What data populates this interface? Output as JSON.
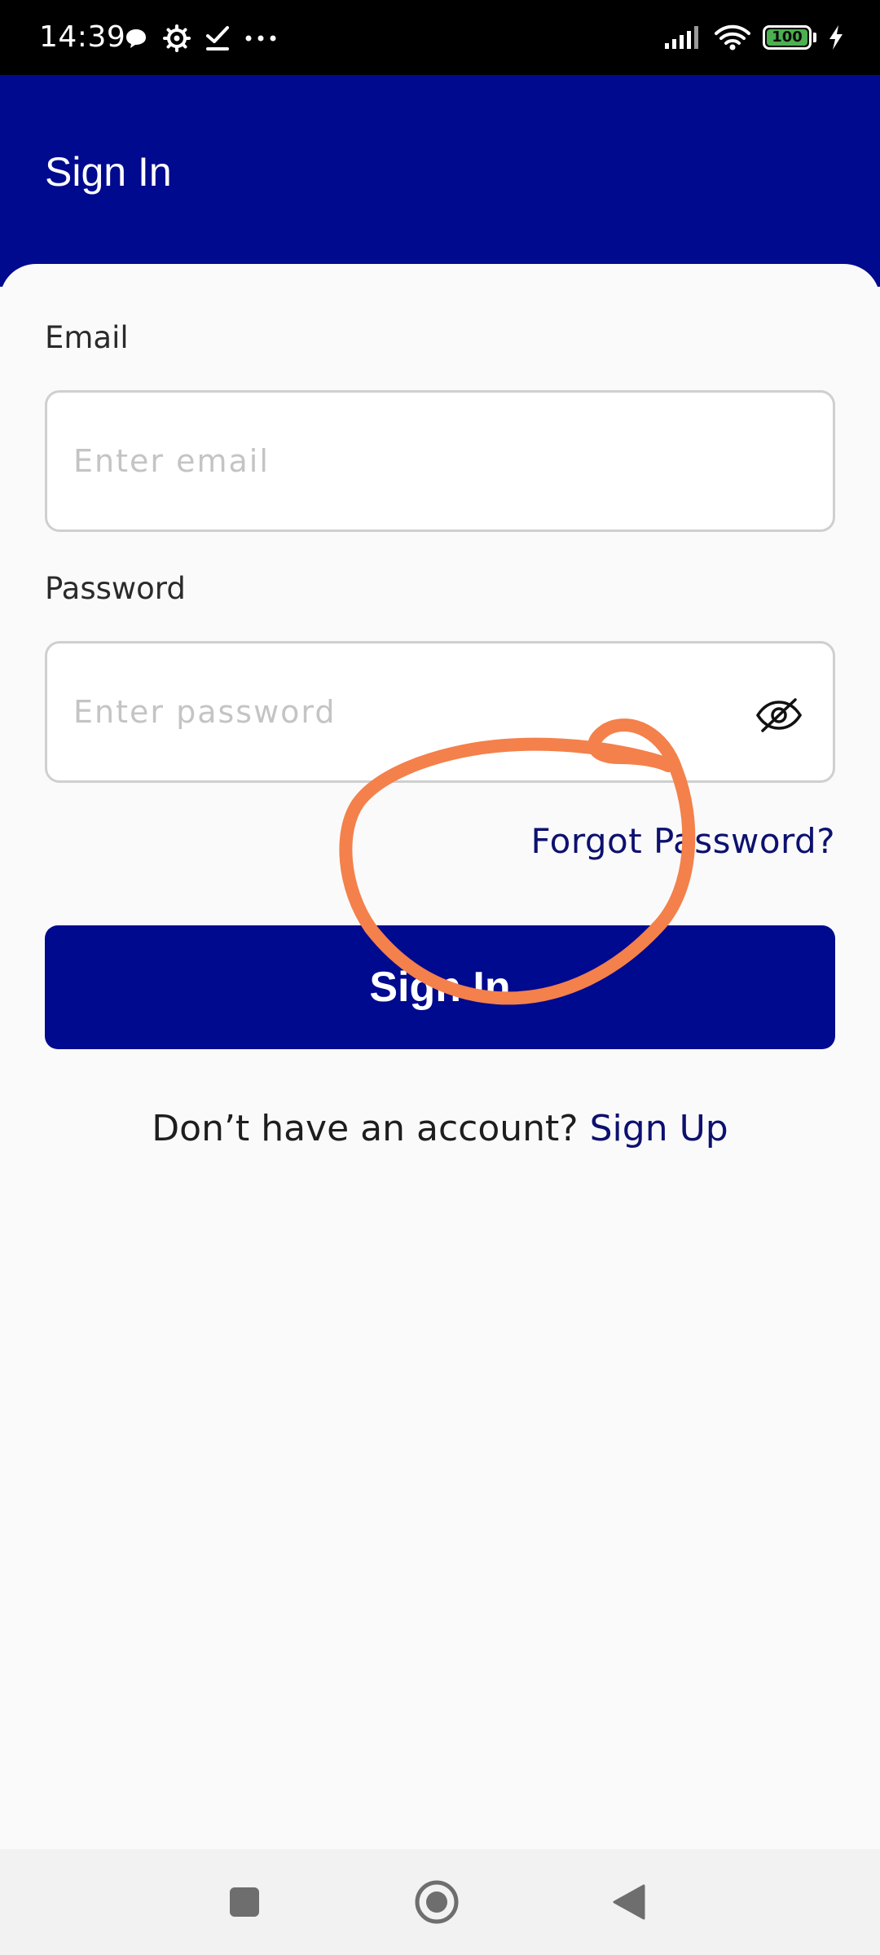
{
  "status_bar": {
    "time": "14:39",
    "battery_level": "100",
    "battery_color": "#4caf50",
    "icons": [
      "chat-bubble-icon",
      "settings-icon",
      "check-icon",
      "more-dots-icon",
      "signal-icon",
      "wifi-icon",
      "battery-icon",
      "charging-icon"
    ]
  },
  "header": {
    "title": "Sign In",
    "background_color": "#000a8e"
  },
  "form": {
    "email": {
      "label": "Email",
      "placeholder": "Enter email",
      "value": ""
    },
    "password": {
      "label": "Password",
      "placeholder": "Enter password",
      "value": "",
      "visibility_icon": "eye-off-icon"
    },
    "forgot_password_label": "Forgot Password?",
    "submit_label": "Sign In"
  },
  "signup": {
    "prompt": "Don’t have an account?",
    "link_label": "Sign Up"
  },
  "annotation": {
    "color": "#f4804b"
  },
  "nav_bar": {
    "icons": [
      "recents-square-icon",
      "home-circle-icon",
      "back-triangle-icon"
    ]
  }
}
